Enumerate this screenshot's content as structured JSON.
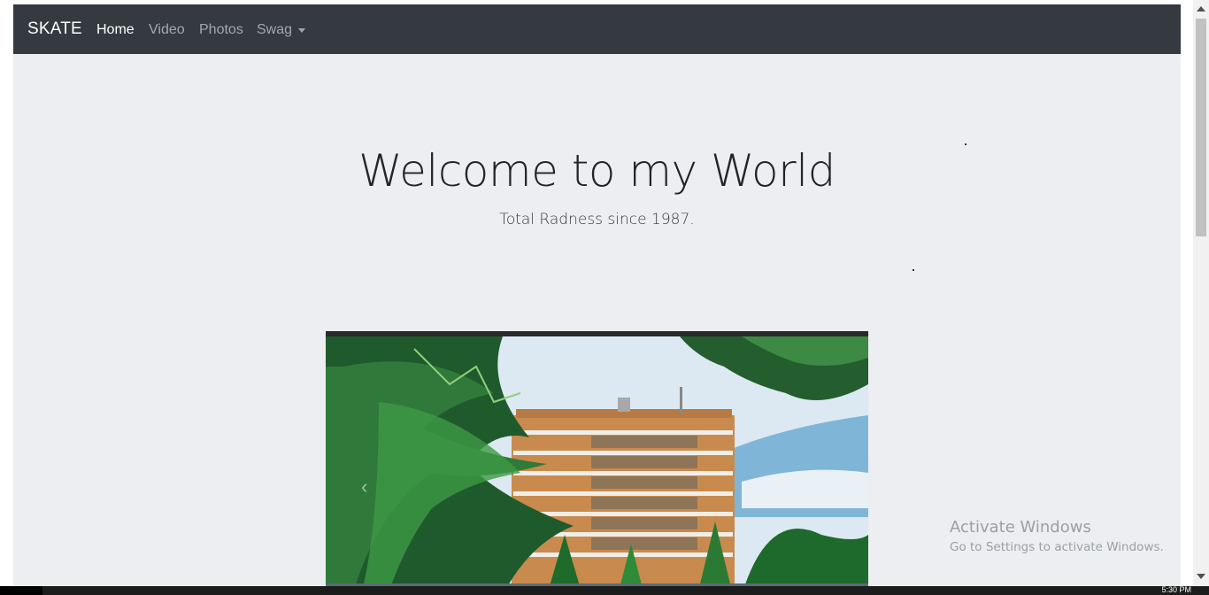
{
  "navbar": {
    "brand": "SKATE",
    "links": [
      {
        "label": "Home",
        "active": true
      },
      {
        "label": "Video",
        "active": false
      },
      {
        "label": "Photos",
        "active": false
      },
      {
        "label": "Swag",
        "active": false,
        "dropdown": true
      }
    ]
  },
  "hero": {
    "title": "Welcome to my World",
    "subtitle": "Total Radness since 1987."
  },
  "carousel": {
    "prev_icon": "chevron-left-icon"
  },
  "watermark": {
    "title": "Activate Windows",
    "subtitle": "Go to Settings to activate Windows."
  },
  "taskbar": {
    "time": "5:30 PM"
  },
  "colors": {
    "navbar_bg": "#343a40",
    "jumbotron_bg": "#eceef1",
    "nav_active": "#ffffff",
    "nav_inactive": "#9a9da0"
  }
}
